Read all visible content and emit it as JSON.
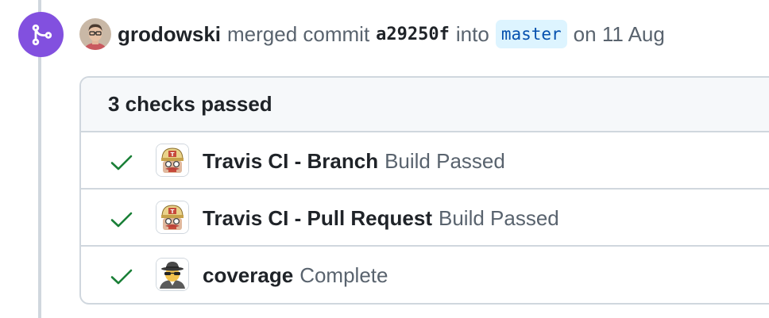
{
  "event": {
    "author": "grodowski",
    "action_text": "merged commit",
    "commit_sha": "a29250f",
    "into_text": "into",
    "branch": "master",
    "date_text": "on 11 Aug",
    "merge_icon": "git-merge-icon",
    "avatar_icon": "user-avatar"
  },
  "checks": {
    "summary": "3 checks passed",
    "items": [
      {
        "name": "Travis CI - Branch",
        "status": "Build Passed",
        "icon": "travis-ci-logo"
      },
      {
        "name": "Travis CI - Pull Request",
        "status": "Build Passed",
        "icon": "travis-ci-logo"
      },
      {
        "name": "coverage",
        "status": "Complete",
        "icon": "spy-logo"
      }
    ]
  },
  "colors": {
    "merge_purple": "#8250df",
    "success_green": "#1a7f37",
    "branch_bg": "#ddf4ff",
    "branch_text": "#0550ae",
    "muted_text": "#59636e",
    "border": "#d0d7de"
  }
}
